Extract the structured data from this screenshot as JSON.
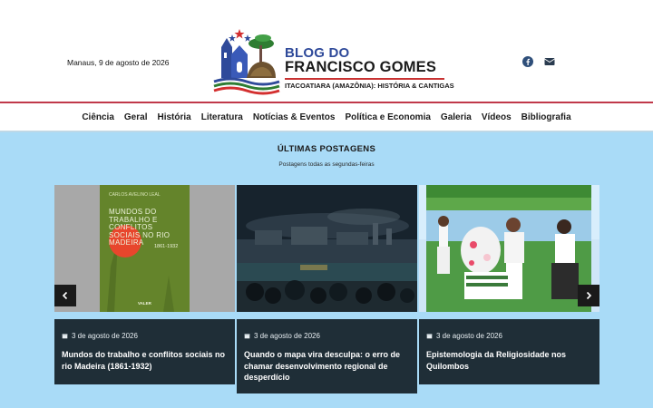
{
  "header": {
    "date": "Manaus, 9 de agosto de 2026",
    "logo": {
      "line1": "BLOG DO",
      "line2": "FRANCISCO GOMES",
      "line3": "ITACOATIARA (AMAZÔNIA): HISTÓRIA & CANTIGAS"
    },
    "social_icons": [
      "facebook-icon",
      "envelope-icon"
    ]
  },
  "nav": {
    "items": [
      "Ciência",
      "Geral",
      "História",
      "Literatura",
      "Notícias & Eventos",
      "Política e Economia",
      "Galeria",
      "Vídeos",
      "Bibliografia"
    ]
  },
  "main": {
    "title": "ÚLTIMAS POSTAGENS",
    "subtitle": "Postagens todas as segundas-feiras",
    "posts": [
      {
        "date": "3 de agosto de 2026",
        "title": "Mundos do trabalho e conflitos sociais no rio Madeira (1861-1932)",
        "image": {
          "author": "CARLOS AVELINO LEAL",
          "book_title": "MUNDOS DO TRABALHO E CONFLITOS SOCIAIS NO RIO MADEIRA",
          "years": "1861-1932",
          "publisher": "VALER"
        }
      },
      {
        "date": "3 de agosto de 2026",
        "title": "Quando o mapa vira desculpa: o erro de chamar desenvolvimento regional de desperdício"
      },
      {
        "date": "3 de agosto de 2026",
        "title": "Epistemologia da Religiosidade nos Quilombos"
      }
    ],
    "prev_icon": "chevron-left-icon",
    "next_icon": "chevron-right-icon"
  },
  "colors": {
    "brand_blue": "#2f4a9a",
    "accent_red": "#c0394a",
    "section_bg": "#a9dbf7",
    "card_bg": "#1f2e37"
  }
}
